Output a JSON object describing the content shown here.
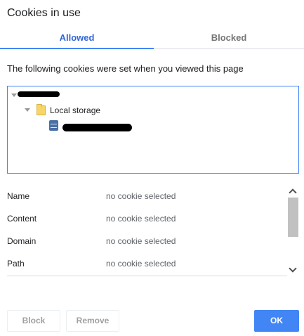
{
  "dialog": {
    "title": "Cookies in use"
  },
  "tabs": [
    {
      "label": "Allowed",
      "selected": true
    },
    {
      "label": "Blocked",
      "selected": false
    }
  ],
  "description": "The following cookies were set when you viewed this page",
  "tree": {
    "root": {
      "label_redacted": true
    },
    "storage": {
      "label": "Local storage",
      "icon": "folder-icon"
    },
    "item": {
      "label_redacted": true,
      "icon": "database-icon"
    }
  },
  "details": {
    "rows": [
      {
        "label": "Name",
        "value": "no cookie selected"
      },
      {
        "label": "Content",
        "value": "no cookie selected"
      },
      {
        "label": "Domain",
        "value": "no cookie selected"
      },
      {
        "label": "Path",
        "value": "no cookie selected"
      }
    ]
  },
  "buttons": {
    "block": "Block",
    "remove": "Remove",
    "ok": "OK"
  },
  "colors": {
    "accent": "#4285f4",
    "tab_selected_text": "#3367d6",
    "disabled_text": "#a0a0a0"
  }
}
